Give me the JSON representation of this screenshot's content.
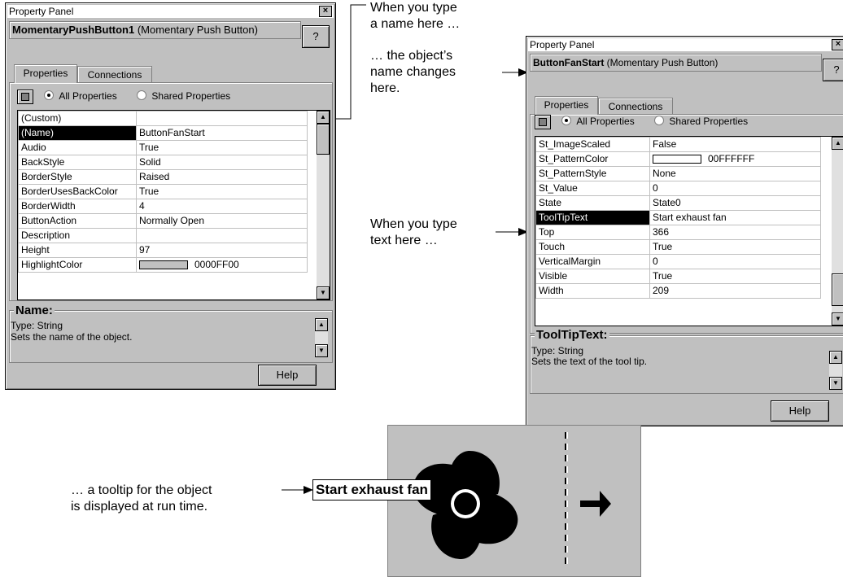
{
  "left_panel": {
    "title": "Property Panel",
    "close_glyph": "×",
    "object_name": "MomentaryPushButton1",
    "object_type": " (Momentary Push Button)",
    "help_q": "?",
    "tabs": [
      {
        "label": "Properties",
        "underline": "P"
      },
      {
        "label": "Connections",
        "underline": "C"
      }
    ],
    "radio_all": "All Properties",
    "radio_shared": "Shared Properties",
    "rows": [
      {
        "key": "(Custom)",
        "value": ""
      },
      {
        "key": "(Name)",
        "value": "ButtonFanStart"
      },
      {
        "key": "Audio",
        "value": "True"
      },
      {
        "key": "BackStyle",
        "value": "Solid"
      },
      {
        "key": "BorderStyle",
        "value": "Raised"
      },
      {
        "key": "BorderUsesBackColor",
        "value": "True"
      },
      {
        "key": "BorderWidth",
        "value": "4"
      },
      {
        "key": "ButtonAction",
        "value": "Normally Open"
      },
      {
        "key": "Description",
        "value": ""
      },
      {
        "key": "Height",
        "value": "97"
      },
      {
        "key": "HighlightColor",
        "value": "0000FF00"
      }
    ],
    "desc_title": "Name:",
    "desc_type": "Type: String",
    "desc_text": "Sets the name of the object.",
    "help_label": "Help"
  },
  "right_panel": {
    "title": "Property Panel",
    "close_glyph": "×",
    "object_name": "ButtonFanStart",
    "object_type": " (Momentary Push Button)",
    "help_q": "?",
    "tabs": [
      {
        "label": "Properties"
      },
      {
        "label": "Connections"
      }
    ],
    "radio_all": "All Properties",
    "radio_shared": "Shared Properties",
    "rows": [
      {
        "key": "St_ImageScaled",
        "value": "False"
      },
      {
        "key": "St_PatternColor",
        "value": "00FFFFFF"
      },
      {
        "key": "St_PatternStyle",
        "value": "None"
      },
      {
        "key": "St_Value",
        "value": "0"
      },
      {
        "key": "State",
        "value": "State0"
      },
      {
        "key": "ToolTipText",
        "value": "Start exhaust fan"
      },
      {
        "key": "Top",
        "value": "366"
      },
      {
        "key": "Touch",
        "value": "True"
      },
      {
        "key": "VerticalMargin",
        "value": "0"
      },
      {
        "key": "Visible",
        "value": "True"
      },
      {
        "key": "Width",
        "value": "209"
      }
    ],
    "desc_title": "ToolTipText:",
    "desc_type": "Type: String",
    "desc_text": "Sets the text of the tool tip.",
    "help_label": "Help"
  },
  "callouts": {
    "name_here_1": "When you type",
    "name_here_2": "a name here …",
    "changes_1": "… the object’s",
    "changes_2": "name changes",
    "changes_3": "here.",
    "text_here_1": "When you type",
    "text_here_2": "text here …",
    "tooltip_1": "… a tooltip for the object",
    "tooltip_2": "is displayed at run time."
  },
  "tooltip": {
    "text": "Start exhaust fan"
  },
  "colors": {
    "selected_row": "#000000",
    "panel_gray": "#c0c0c0"
  },
  "icons": {
    "fan": "fan-icon",
    "arrow": "right-arrow-icon"
  }
}
